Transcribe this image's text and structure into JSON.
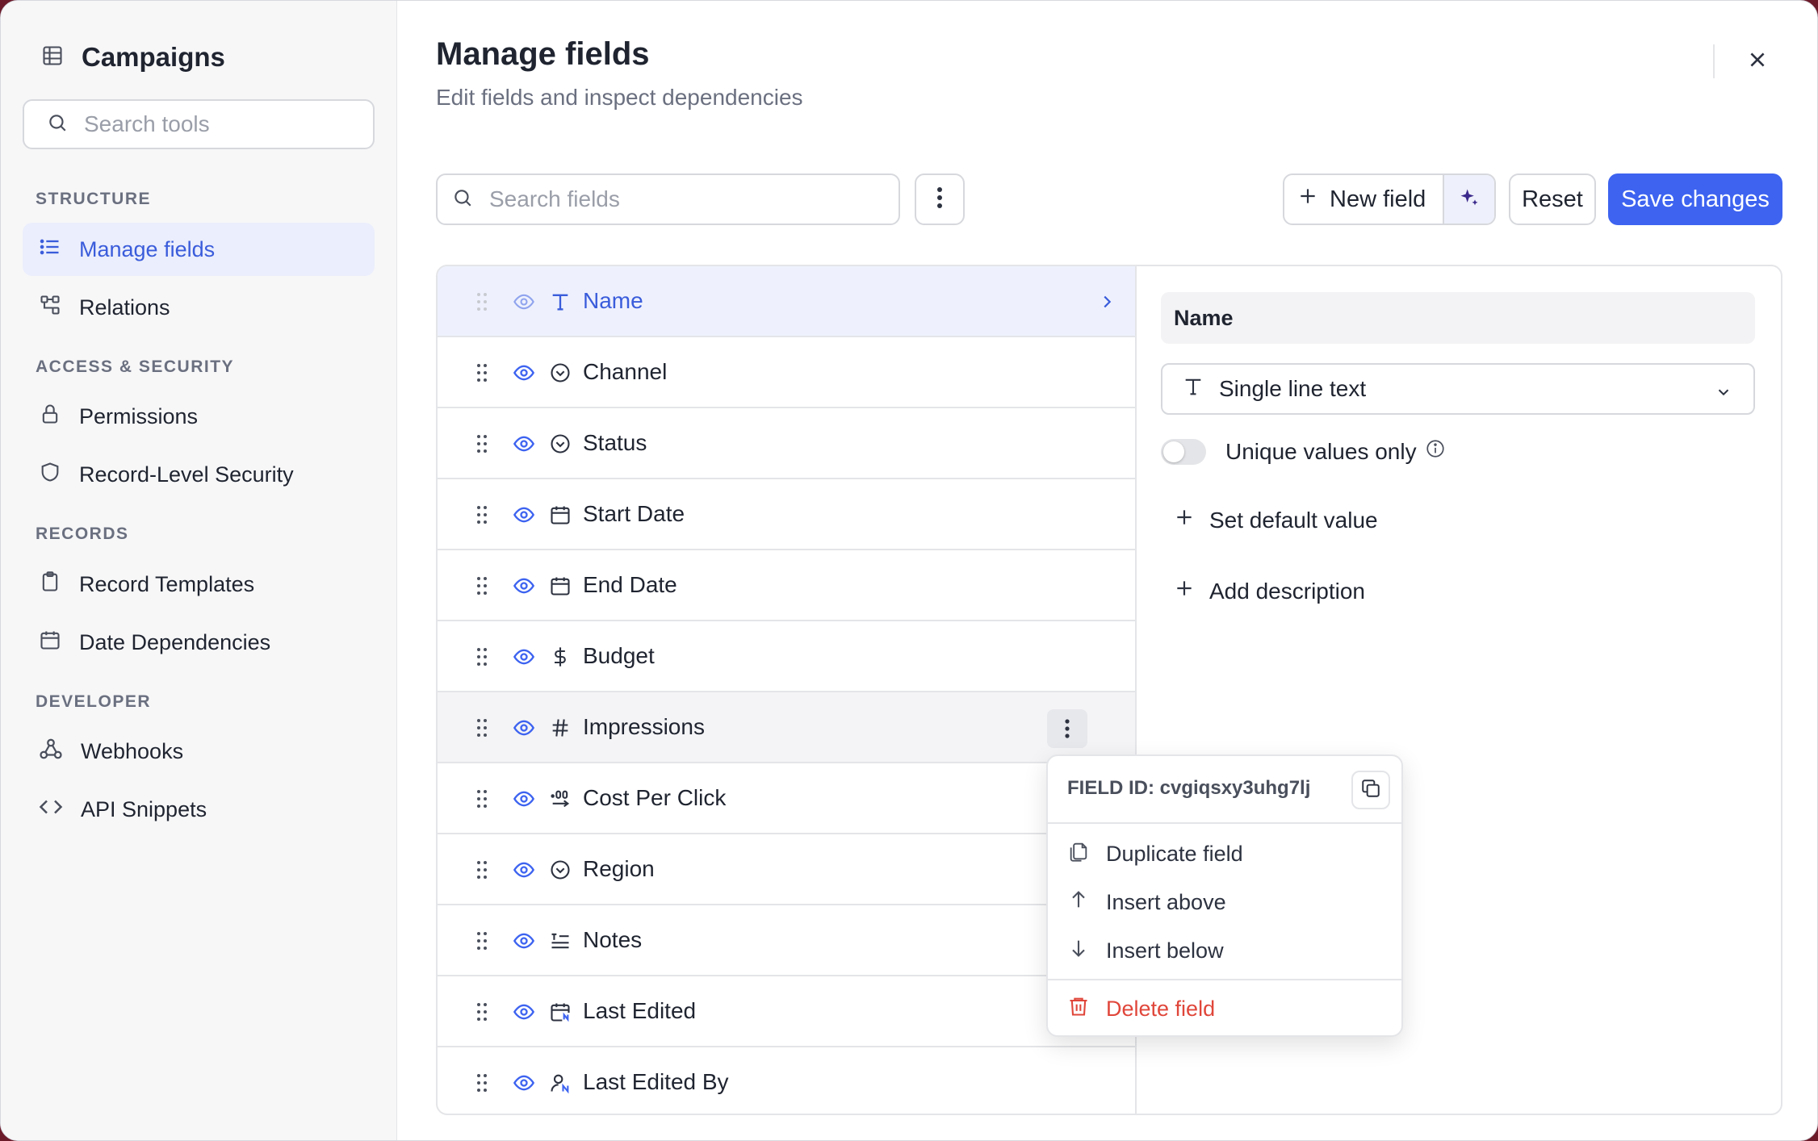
{
  "sidebar": {
    "title": "Campaigns",
    "search_placeholder": "Search tools",
    "sections": [
      {
        "label": "STRUCTURE"
      },
      {
        "label": "ACCESS & SECURITY"
      },
      {
        "label": "RECORDS"
      },
      {
        "label": "DEVELOPER"
      }
    ],
    "items": [
      {
        "label": "Manage fields",
        "icon": "list-icon",
        "active": true
      },
      {
        "label": "Relations",
        "icon": "relations-icon"
      },
      {
        "label": "Permissions",
        "icon": "lock-icon"
      },
      {
        "label": "Record-Level Security",
        "icon": "shield-icon"
      },
      {
        "label": "Record Templates",
        "icon": "clipboard-icon"
      },
      {
        "label": "Date Dependencies",
        "icon": "calendar-icon"
      },
      {
        "label": "Webhooks",
        "icon": "webhook-icon"
      },
      {
        "label": "API Snippets",
        "icon": "code-icon"
      }
    ]
  },
  "header": {
    "title": "Manage fields",
    "subtitle": "Edit fields and inspect dependencies"
  },
  "toolbar": {
    "search_placeholder": "Search fields",
    "new_field_label": "New field",
    "reset_label": "Reset",
    "save_label": "Save changes"
  },
  "fields": [
    {
      "label": "Name",
      "type_icon": "text-type-icon"
    },
    {
      "label": "Channel",
      "type_icon": "select-type-icon"
    },
    {
      "label": "Status",
      "type_icon": "select-type-icon"
    },
    {
      "label": "Start Date",
      "type_icon": "date-type-icon"
    },
    {
      "label": "End Date",
      "type_icon": "date-type-icon"
    },
    {
      "label": "Budget",
      "type_icon": "currency-type-icon"
    },
    {
      "label": "Impressions",
      "type_icon": "number-type-icon"
    },
    {
      "label": "Cost Per Click",
      "type_icon": "decimal-type-icon"
    },
    {
      "label": "Region",
      "type_icon": "select-type-icon"
    },
    {
      "label": "Notes",
      "type_icon": "long-text-type-icon"
    },
    {
      "label": "Last Edited",
      "type_icon": "edited-date-type-icon"
    },
    {
      "label": "Last Edited By",
      "type_icon": "user-type-icon"
    }
  ],
  "details": {
    "name_value": "Name",
    "type_label": "Single line text",
    "unique_label": "Unique values only",
    "set_default_label": "Set default value",
    "add_description_label": "Add description"
  },
  "context_menu": {
    "field_id_label": "FIELD ID: cvgiqsxy3uhg7lj",
    "duplicate_label": "Duplicate field",
    "insert_above_label": "Insert above",
    "insert_below_label": "Insert below",
    "delete_label": "Delete field"
  },
  "colors": {
    "accent": "#3d63f0",
    "active_text": "#3a5cdb",
    "danger": "#e0463a"
  }
}
